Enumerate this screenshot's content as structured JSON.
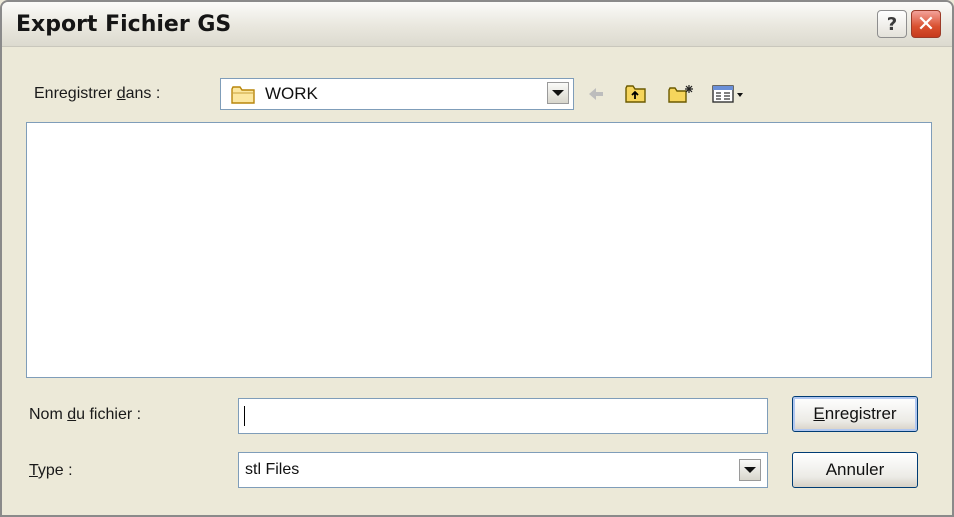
{
  "window": {
    "title": "Export Fichier GS",
    "help_symbol": "?",
    "close_symbol": "✕"
  },
  "save_in": {
    "label_before": "Enregistrer ",
    "label_accel": "d",
    "label_after": "ans :",
    "folder": "WORK",
    "folder_icon": "folder-icon"
  },
  "toolbar": {
    "icons": [
      "back-arrow-icon",
      "up-folder-icon",
      "new-folder-icon",
      "view-menu-icon"
    ]
  },
  "file_name": {
    "label_before": "Nom ",
    "label_accel": "d",
    "label_after": "u fichier :",
    "value": "",
    "placeholder": ""
  },
  "file_type": {
    "label_accel": "T",
    "label_after": "ype :",
    "selected": "stl Files"
  },
  "buttons": {
    "save_accel": "E",
    "save_rest": "nregistrer",
    "cancel": "Annuler"
  },
  "colors": {
    "dialog_bg": "#ECE9D8",
    "field_border": "#7F9DB9",
    "close_red": "#D9502F",
    "button_border": "#003C74"
  }
}
